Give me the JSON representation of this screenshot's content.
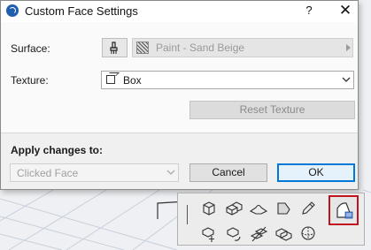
{
  "dialog": {
    "title": "Custom Face Settings",
    "help_label": "?",
    "close_label": "✕",
    "surface_label": "Surface:",
    "surface_value": "Paint - Sand Beige",
    "texture_label": "Texture:",
    "texture_value": "Box",
    "reset_texture_label": "Reset Texture",
    "apply_label": "Apply changes to:",
    "apply_value": "Clicked Face",
    "cancel_label": "Cancel",
    "ok_label": "OK"
  },
  "icons": {
    "app": "archicad-logo-icon",
    "brush": "brush-icon",
    "surface_swatch": "hatch-swatch-icon",
    "texture_box": "box-icon",
    "toolbar": [
      "cube-icon",
      "box-stack-icon",
      "surface-icon",
      "face-icon",
      "pencil-icon",
      "custom-face-icon",
      "move-icon",
      "rotate-icon",
      "align-icon",
      "stack-icon",
      "sphere-icon"
    ]
  },
  "colors": {
    "ok_border": "#0078d7",
    "selected_tool_border": "#c0151e"
  }
}
